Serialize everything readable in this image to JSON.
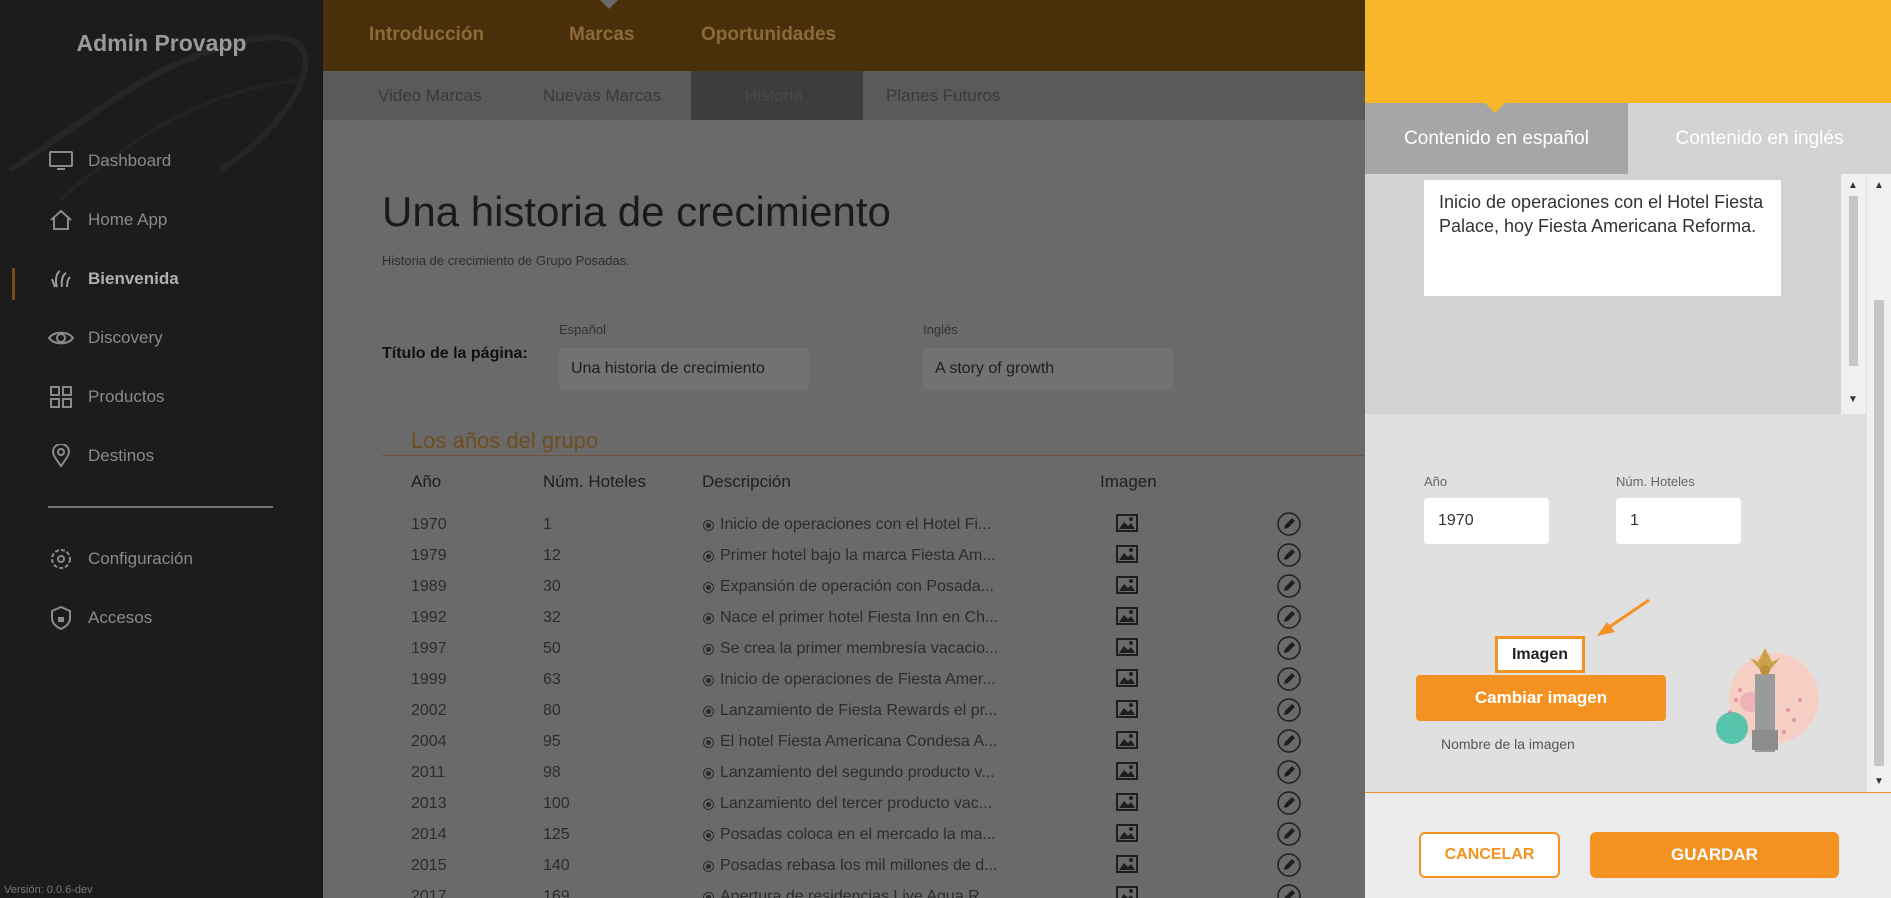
{
  "sidebar": {
    "brand": "Admin Provapp",
    "items": [
      {
        "label": "Dashboard",
        "icon": "monitor-icon"
      },
      {
        "label": "Home App",
        "icon": "home-icon"
      },
      {
        "label": "Bienvenida",
        "icon": "wave-hand-icon",
        "active": true
      },
      {
        "label": "Discovery",
        "icon": "eye-icon"
      },
      {
        "label": "Productos",
        "icon": "grid-icon"
      },
      {
        "label": "Destinos",
        "icon": "map-pin-icon"
      },
      {
        "label": "Configuración",
        "icon": "gear-icon"
      },
      {
        "label": "Accesos",
        "icon": "lock-shield-icon"
      }
    ],
    "version": "Versión: 0.0.6-dev"
  },
  "topnav": {
    "tabs": [
      "Introducción",
      "Marcas",
      "Oportunidades"
    ],
    "active_tab": "Marcas"
  },
  "subnav": {
    "tabs": [
      "Video Marcas",
      "Nuevas Marcas",
      "Historia",
      "Planes Futuros"
    ],
    "active_tab": "Historia"
  },
  "page": {
    "title": "Una historia de crecimiento",
    "subtitle": "Historia de crecimiento de Grupo Posadas.",
    "title_label": "Título de la página:",
    "es_label": "Español",
    "en_label": "Inglés",
    "es_value": "Una historia de crecimiento",
    "en_value": "A story of growth",
    "section_title": "Los años del grupo"
  },
  "table": {
    "headers": [
      "Año",
      "Núm. Hoteles",
      "Descripción",
      "Imagen"
    ],
    "rows": [
      {
        "year": "1970",
        "hotels": "1",
        "desc": "Inicio de operaciones con el Hotel Fi..."
      },
      {
        "year": "1979",
        "hotels": "12",
        "desc": "Primer hotel bajo la marca Fiesta Am..."
      },
      {
        "year": "1989",
        "hotels": "30",
        "desc": "Expansión de operación con Posada..."
      },
      {
        "year": "1992",
        "hotels": "32",
        "desc": "Nace el primer hotel Fiesta Inn en Ch..."
      },
      {
        "year": "1997",
        "hotels": "50",
        "desc": "Se crea la primer membresía vacacio..."
      },
      {
        "year": "1999",
        "hotels": "63",
        "desc": "Inicio de operaciones de Fiesta Amer..."
      },
      {
        "year": "2002",
        "hotels": "80",
        "desc": "Lanzamiento de Fiesta Rewards el pr..."
      },
      {
        "year": "2004",
        "hotels": "95",
        "desc": "El hotel Fiesta Americana Condesa A..."
      },
      {
        "year": "2011",
        "hotels": "98",
        "desc": "Lanzamiento del segundo producto v..."
      },
      {
        "year": "2013",
        "hotels": "100",
        "desc": "Lanzamiento del tercer producto vac..."
      },
      {
        "year": "2014",
        "hotels": "125",
        "desc": "Posadas coloca en el mercado la ma..."
      },
      {
        "year": "2015",
        "hotels": "140",
        "desc": "Posadas rebasa los mil millones de d..."
      },
      {
        "year": "2017",
        "hotels": "169",
        "desc": "Apertura de residencias Live Aqua R..."
      }
    ]
  },
  "panel": {
    "tab_es": "Contenido en español",
    "tab_en": "Contenido en inglés",
    "description": "Inicio de operaciones con el Hotel Fiesta Palace, hoy Fiesta Americana Reforma.",
    "year_label": "Año",
    "year_value": "1970",
    "hotels_label": "Núm. Hoteles",
    "hotels_value": "1",
    "image_label": "Imagen",
    "change_image": "Cambiar imagen",
    "image_name_label": "Nombre de la imagen",
    "cancel": "CANCELAR",
    "save": "GUARDAR"
  },
  "colors": {
    "accent": "#f39220",
    "panel_header": "#f8b72a"
  }
}
